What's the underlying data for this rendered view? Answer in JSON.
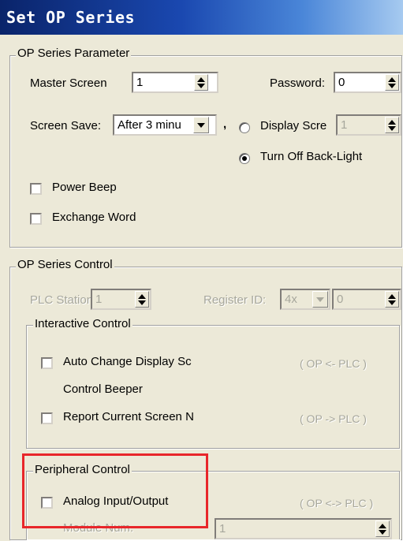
{
  "window": {
    "title": "Set OP Series"
  },
  "op_series_parameter": {
    "legend": "OP Series Parameter",
    "master_screen_label": "Master Screen",
    "master_screen_value": "1",
    "password_label": "Password:",
    "password_value": "0",
    "screen_save_label": "Screen Save:",
    "screen_save_value": "After 3 minu",
    "comma": ",",
    "display_screen_label": "Display Scre",
    "display_screen_value": "1",
    "turn_off_backlight_label": "Turn Off Back-Light",
    "power_beep_label": "Power Beep",
    "exchange_word_label": "Exchange Word"
  },
  "op_series_control": {
    "legend": "OP Series Control",
    "plc_station_label": "PLC Station",
    "plc_station_value": "1",
    "register_id_label": "Register ID:",
    "register_type_value": "4x",
    "register_id_value": "0",
    "interactive": {
      "legend": "Interactive Control",
      "auto_change_label": "Auto Change Display Sc",
      "auto_change_dir": "( OP <- PLC )",
      "control_beeper_label": "Control Beeper",
      "report_current_label": "Report Current Screen N",
      "report_current_dir": "( OP -> PLC )"
    }
  },
  "peripheral_control": {
    "legend": "Peripheral Control",
    "analog_io_label": "Analog Input/Output",
    "analog_io_dir": "( OP <-> PLC )",
    "module_num_label": "Module Num.",
    "module_num_value": "1"
  },
  "colors": {
    "highlight_box": "#e8262a",
    "title_bar": "#0a246a"
  }
}
